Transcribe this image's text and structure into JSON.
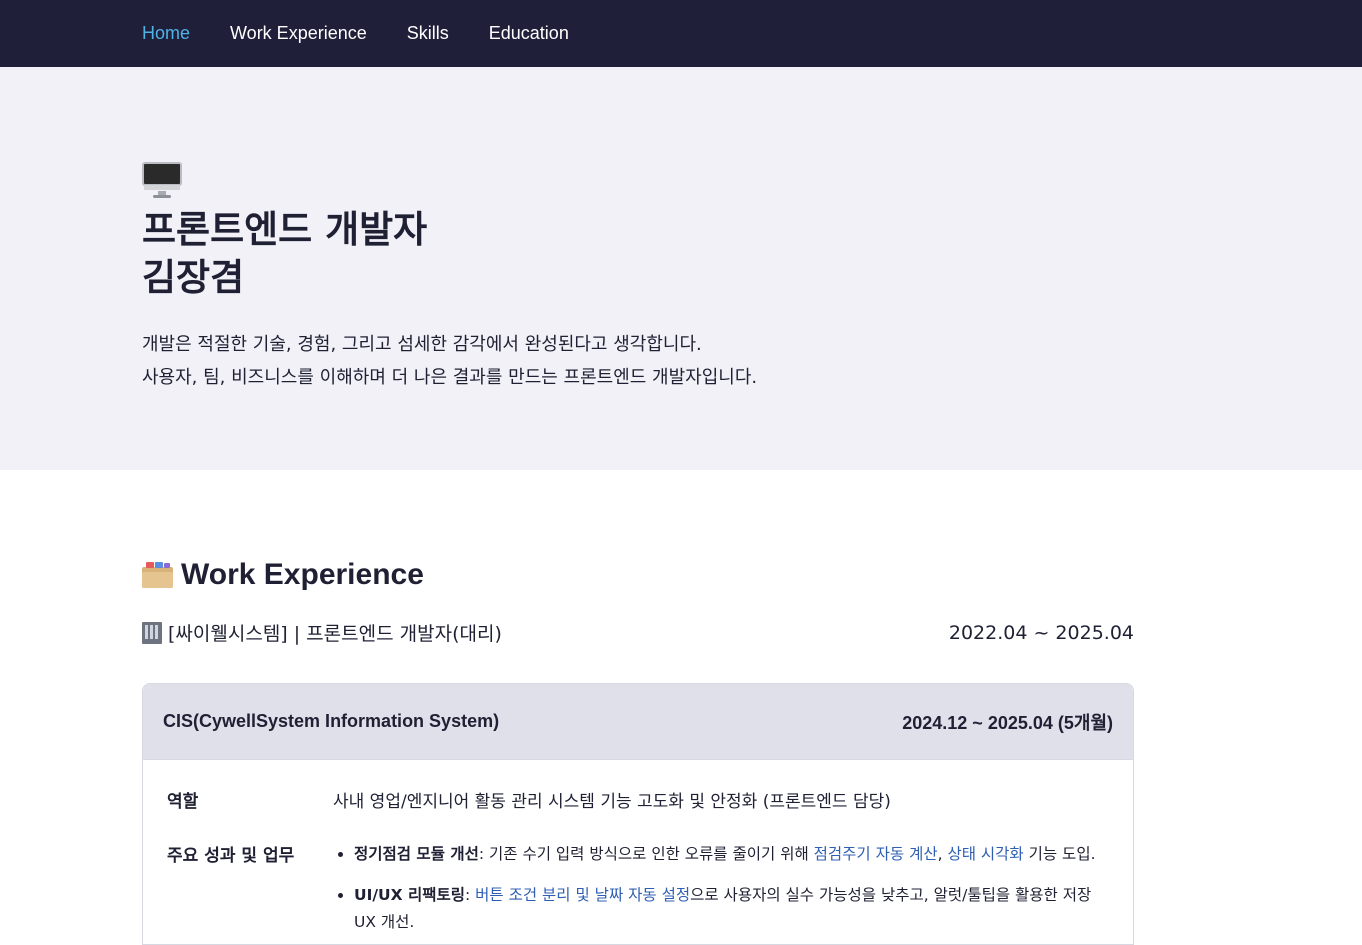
{
  "nav": {
    "items": [
      {
        "label": "Home",
        "active": true
      },
      {
        "label": "Work Experience",
        "active": false
      },
      {
        "label": "Skills",
        "active": false
      },
      {
        "label": "Education",
        "active": false
      }
    ]
  },
  "hero": {
    "icon": "desktop-computer-icon",
    "title_line1": "프론트엔드 개발자",
    "title_line2": "김장겸",
    "desc_line1": "개발은 적절한 기술, 경험, 그리고 섬세한 감각에서 완성된다고 생각합니다.",
    "desc_line2": "사용자, 팀, 비즈니스를 이해하며 더 나은 결과를 만드는 프론트엔드 개발자입니다."
  },
  "work": {
    "icon": "card-file-box-icon",
    "title": "Work Experience",
    "company_icon": "office-building-icon",
    "company": "[싸이웰시스템] | 프론트엔드 개발자(대리)",
    "period": "2022.04 ~ 2025.04",
    "project": {
      "name": "CIS(CywellSystem Information System)",
      "period": "2024.12 ~ 2025.04 (5개월)",
      "role_label": "역할",
      "role_value": "사내 영업/엔지니어 활동 관리 시스템 기능 고도화 및 안정화 (프론트엔드 담당)",
      "achievements_label": "주요 성과 및 업무",
      "achievements": [
        {
          "bold": "정기점검 모듈 개선",
          "text1": ": 기존 수기 입력 방식으로 인한 오류를 줄이기 위해 ",
          "hl1": "점검주기 자동 계산",
          "sep": ", ",
          "hl2": "상태 시각화",
          "text2": " 기능 도입."
        },
        {
          "bold": "UI/UX 리팩토링",
          "text1": ": ",
          "hl1": "버튼 조건 분리 및 날짜 자동 설정",
          "text2": "으로 사용자의 실수 가능성을 낮추고, 알럿/툴팁을 활용한 저장 UX 개선."
        }
      ]
    }
  },
  "colors": {
    "nav_bg": "#1f1f3a",
    "nav_active": "#4fb3e8",
    "hero_bg": "#f1f1f7",
    "card_head_bg": "#e0e0eb",
    "highlight": "#2f5fb3"
  }
}
